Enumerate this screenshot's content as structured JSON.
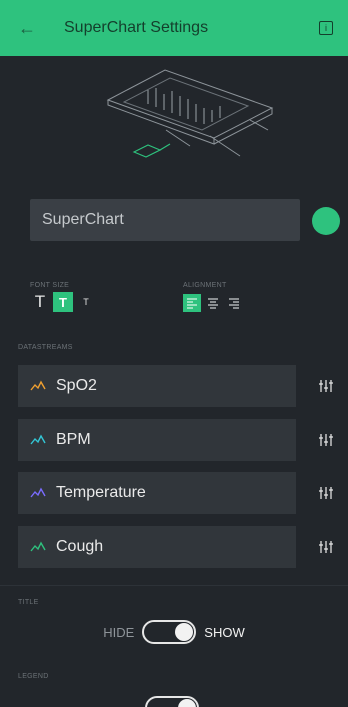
{
  "header": {
    "title": "SuperChart Settings"
  },
  "widget_name": {
    "value": "SuperChart"
  },
  "colors": {
    "accent": "#2ec27e"
  },
  "font_size": {
    "label": "FONT SIZE",
    "options": [
      "T",
      "T",
      "T"
    ],
    "selected_index": 1
  },
  "alignment": {
    "label": "ALIGNMENT",
    "options": [
      "left",
      "center",
      "right"
    ],
    "selected": "left"
  },
  "datastreams": {
    "label": "DATASTREAMS",
    "items": [
      {
        "name": "SpO2",
        "color": "#f0a030"
      },
      {
        "name": "BPM",
        "color": "#33c7d6"
      },
      {
        "name": "Temperature",
        "color": "#7a6cff"
      },
      {
        "name": "Cough",
        "color": "#2ec27e"
      }
    ]
  },
  "title_section": {
    "label": "TITLE",
    "off_label": "HIDE",
    "on_label": "SHOW",
    "state": "show"
  },
  "legend_section": {
    "label": "LEGEND"
  }
}
